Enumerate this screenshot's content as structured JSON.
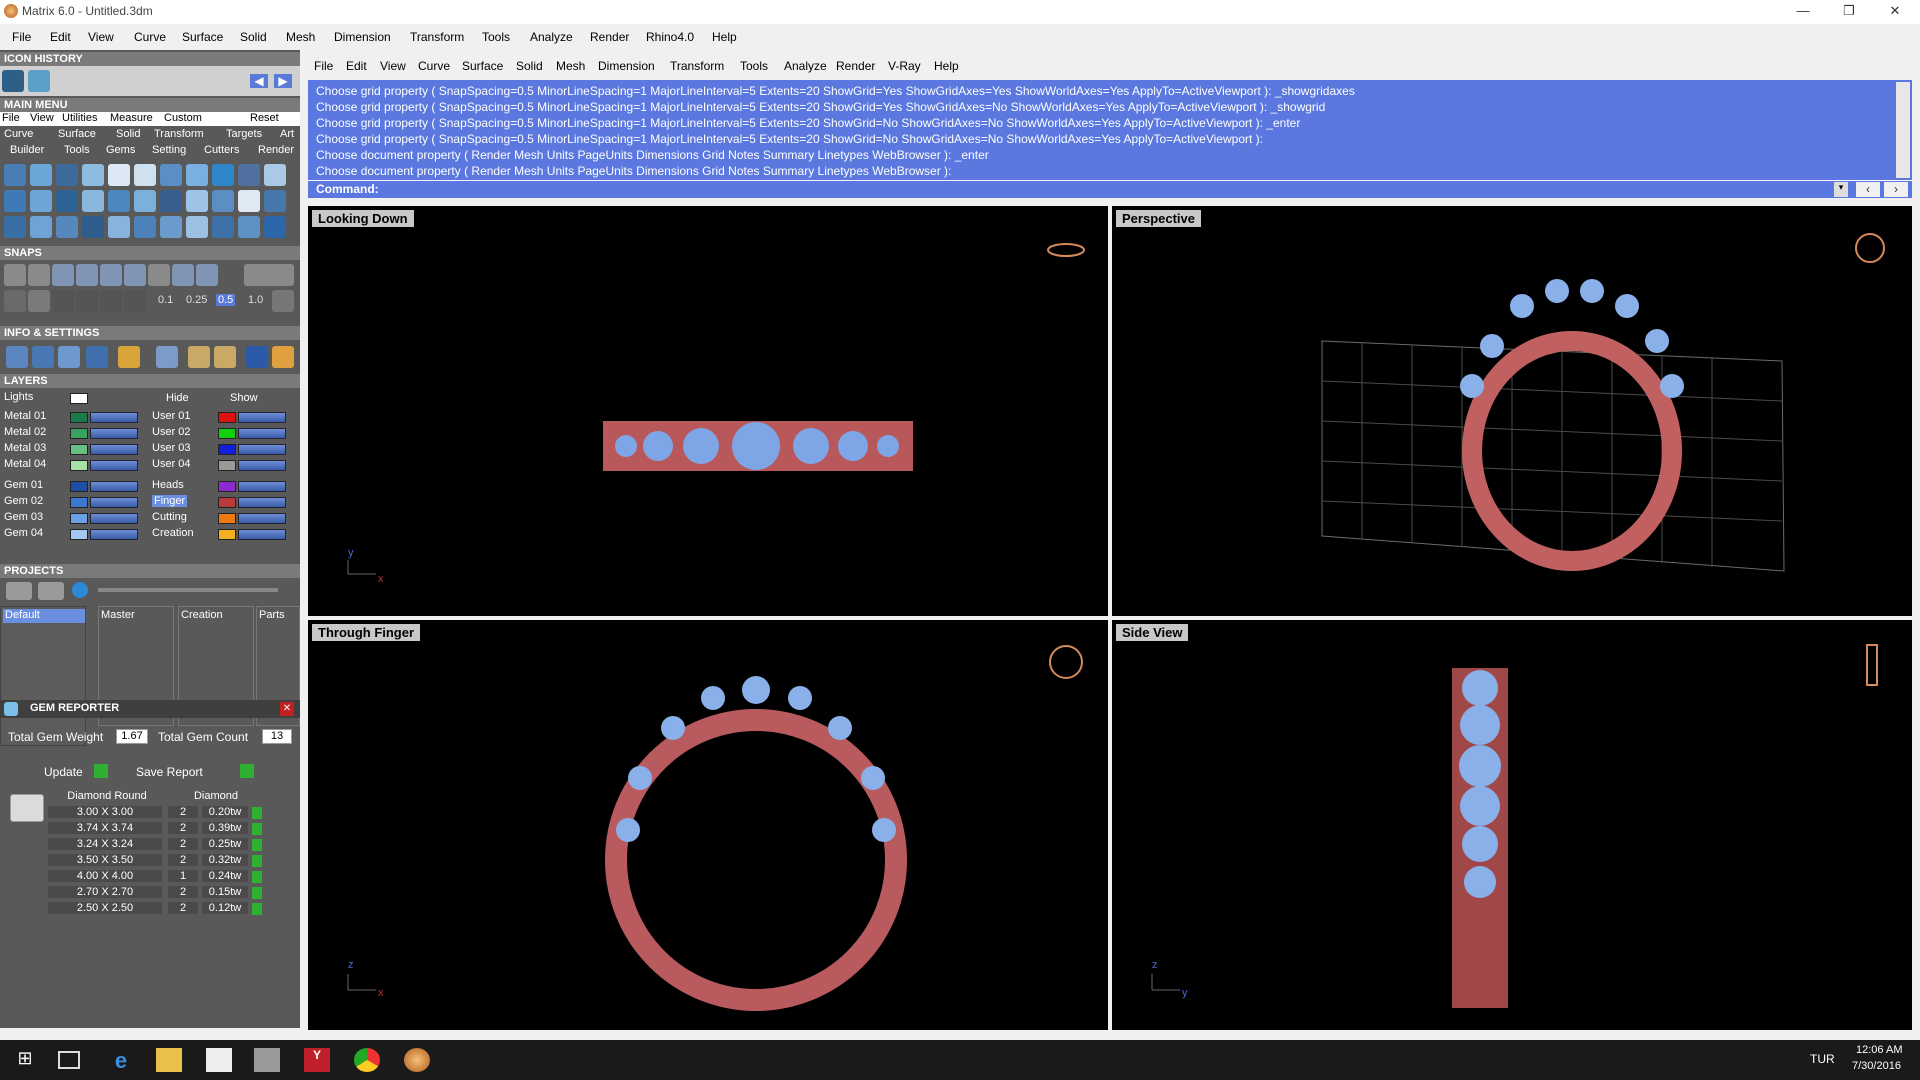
{
  "window": {
    "title": "Matrix 6.0 - Untitled.3dm"
  },
  "menubar": {
    "items": [
      "File",
      "Edit",
      "View",
      "Curve",
      "Surface",
      "Solid",
      "Mesh",
      "Dimension",
      "Transform",
      "Tools",
      "Analyze",
      "Render",
      "Rhino4.0",
      "Help"
    ]
  },
  "submenu": {
    "items": [
      "File",
      "Edit",
      "View",
      "Curve",
      "Surface",
      "Solid",
      "Mesh",
      "Dimension",
      "Transform",
      "Tools",
      "Analyze",
      "Render",
      "V-Ray",
      "Help"
    ]
  },
  "left": {
    "icon_history": "ICON HISTORY",
    "main_menu": "MAIN MENU",
    "main_menu_row1": [
      "File",
      "View",
      "Utilities",
      "Measure",
      "Custom",
      "Reset"
    ],
    "main_menu_row2": [
      "Curve",
      "Surface",
      "Solid",
      "Transform",
      "Targets",
      "Art"
    ],
    "main_menu_row3": [
      "Builder",
      "Tools",
      "Gems",
      "Setting",
      "Cutters",
      "Render"
    ],
    "snaps": "SNAPS",
    "snap_values": [
      "0.1",
      "0.25",
      "0.5",
      "1.0"
    ],
    "info_settings": "INFO & SETTINGS",
    "layers": "LAYERS",
    "hide": "Hide",
    "show": "Show",
    "layers_left": [
      "Lights",
      "Metal 01",
      "Metal 02",
      "Metal 03",
      "Metal 04",
      "Gem 01",
      "Gem 02",
      "Gem 03",
      "Gem 04"
    ],
    "layers_right": [
      "User 01",
      "User 02",
      "User 03",
      "User 04",
      "Heads",
      "Finger",
      "Cutting",
      "Creation"
    ],
    "projects": "PROJECTS",
    "project_default": "Default",
    "project_cols": [
      "Master",
      "Creation",
      "Parts"
    ],
    "gem_reporter": "GEM REPORTER",
    "total_weight_label": "Total Gem Weight",
    "total_weight": "1.67",
    "total_count_label": "Total Gem Count",
    "total_count": "13",
    "update": "Update",
    "save_report": "Save Report",
    "gem_headers": [
      "Diamond Round",
      "Diamond"
    ],
    "gems": [
      {
        "size": "3.00 X 3.00",
        "qty": "2",
        "wt": "0.20tw"
      },
      {
        "size": "3.74 X 3.74",
        "qty": "2",
        "wt": "0.39tw"
      },
      {
        "size": "3.24 X 3.24",
        "qty": "2",
        "wt": "0.25tw"
      },
      {
        "size": "3.50 X 3.50",
        "qty": "2",
        "wt": "0.32tw"
      },
      {
        "size": "4.00 X 4.00",
        "qty": "1",
        "wt": "0.24tw"
      },
      {
        "size": "2.70 X 2.70",
        "qty": "2",
        "wt": "0.15tw"
      },
      {
        "size": "2.50 X 2.50",
        "qty": "2",
        "wt": "0.12tw"
      }
    ]
  },
  "command": {
    "lines": [
      "Choose grid property ( SnapSpacing=0.5  MinorLineSpacing=1  MajorLineInterval=5  Extents=20  ShowGrid=Yes  ShowGridAxes=Yes  ShowWorldAxes=Yes  ApplyTo=ActiveViewport ): _showgridaxes",
      "Choose grid property ( SnapSpacing=0.5  MinorLineSpacing=1  MajorLineInterval=5  Extents=20  ShowGrid=Yes  ShowGridAxes=No  ShowWorldAxes=Yes  ApplyTo=ActiveViewport ): _showgrid",
      "Choose grid property ( SnapSpacing=0.5  MinorLineSpacing=1  MajorLineInterval=5  Extents=20  ShowGrid=No  ShowGridAxes=No  ShowWorldAxes=Yes  ApplyTo=ActiveViewport ): _enter",
      "Choose grid property ( SnapSpacing=0.5  MinorLineSpacing=1  MajorLineInterval=5  Extents=20  ShowGrid=No  ShowGridAxes=No  ShowWorldAxes=Yes  ApplyTo=ActiveViewport ):",
      "Choose document property ( Render  Mesh  Units  PageUnits  Dimensions  Grid  Notes  Summary  Linetypes  WebBrowser ): _enter",
      "Choose document property ( Render  Mesh  Units  PageUnits  Dimensions  Grid  Notes  Summary  Linetypes  WebBrowser ):"
    ],
    "prompt": "Command:"
  },
  "viewports": [
    "Looking Down",
    "Perspective",
    "Through Finger",
    "Side View"
  ],
  "taskbar": {
    "lang": "TUR",
    "time": "12:06 AM",
    "date": "7/30/2016"
  }
}
